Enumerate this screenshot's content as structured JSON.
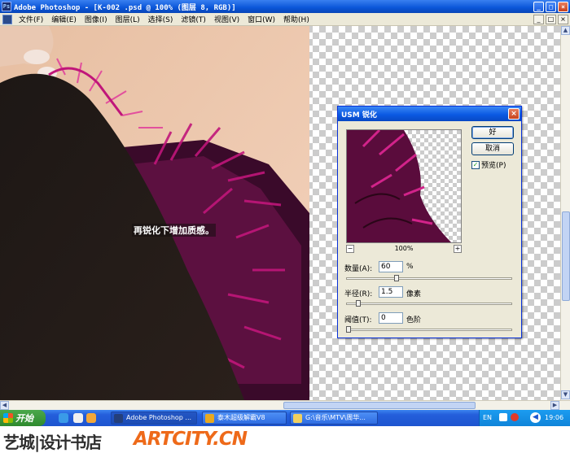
{
  "window": {
    "title": "Adobe Photoshop - [K-002 .psd @ 100% (图层 8, RGB)]",
    "app_icon": "Ps",
    "controls": {
      "minimize": "_",
      "maximize": "□",
      "close": "×"
    }
  },
  "menu": {
    "items": [
      "文件(F)",
      "编辑(E)",
      "图像(I)",
      "图层(L)",
      "选择(S)",
      "滤镜(T)",
      "视图(V)",
      "窗口(W)",
      "帮助(H)"
    ],
    "doc_controls": {
      "minimize": "_",
      "maximize": "□",
      "close": "×"
    }
  },
  "canvas": {
    "caption": "再锐化下增加质感。"
  },
  "dialog": {
    "title": "USM 锐化",
    "close": "×",
    "ok_label": "好",
    "cancel_label": "取消",
    "preview_label": "预览(P)",
    "preview_checked": "✓",
    "zoom_minus": "−",
    "zoom_plus": "+",
    "zoom_value": "100%",
    "amount": {
      "label": "数量(A):",
      "value": "60",
      "unit": "%",
      "slider_fraction": 0.3
    },
    "radius": {
      "label": "半径(R):",
      "value": "1.5",
      "unit": "像素",
      "slider_fraction": 0.06
    },
    "threshold": {
      "label": "阈值(T):",
      "value": "0",
      "unit": "色阶",
      "slider_fraction": 0.0
    }
  },
  "taskbar": {
    "start_label": "开始",
    "tasks": [
      {
        "label": "Adobe Photoshop ...",
        "icon": "photoshop-icon"
      },
      {
        "label": "泰木超级解霸V8",
        "icon": "player-icon"
      },
      {
        "label": "G:\\音乐\\MTV\\周华...",
        "icon": "folder-icon"
      }
    ],
    "tray": {
      "lang": "EN",
      "time": "19:06"
    }
  },
  "watermark": {
    "chinese": "艺城|设计书店",
    "english": "ARTCITY.CN"
  },
  "colors": {
    "xp_blue": "#0a55d8",
    "magenta_feather": "#b0126e",
    "watermark_orange": "#ee6a1a"
  }
}
